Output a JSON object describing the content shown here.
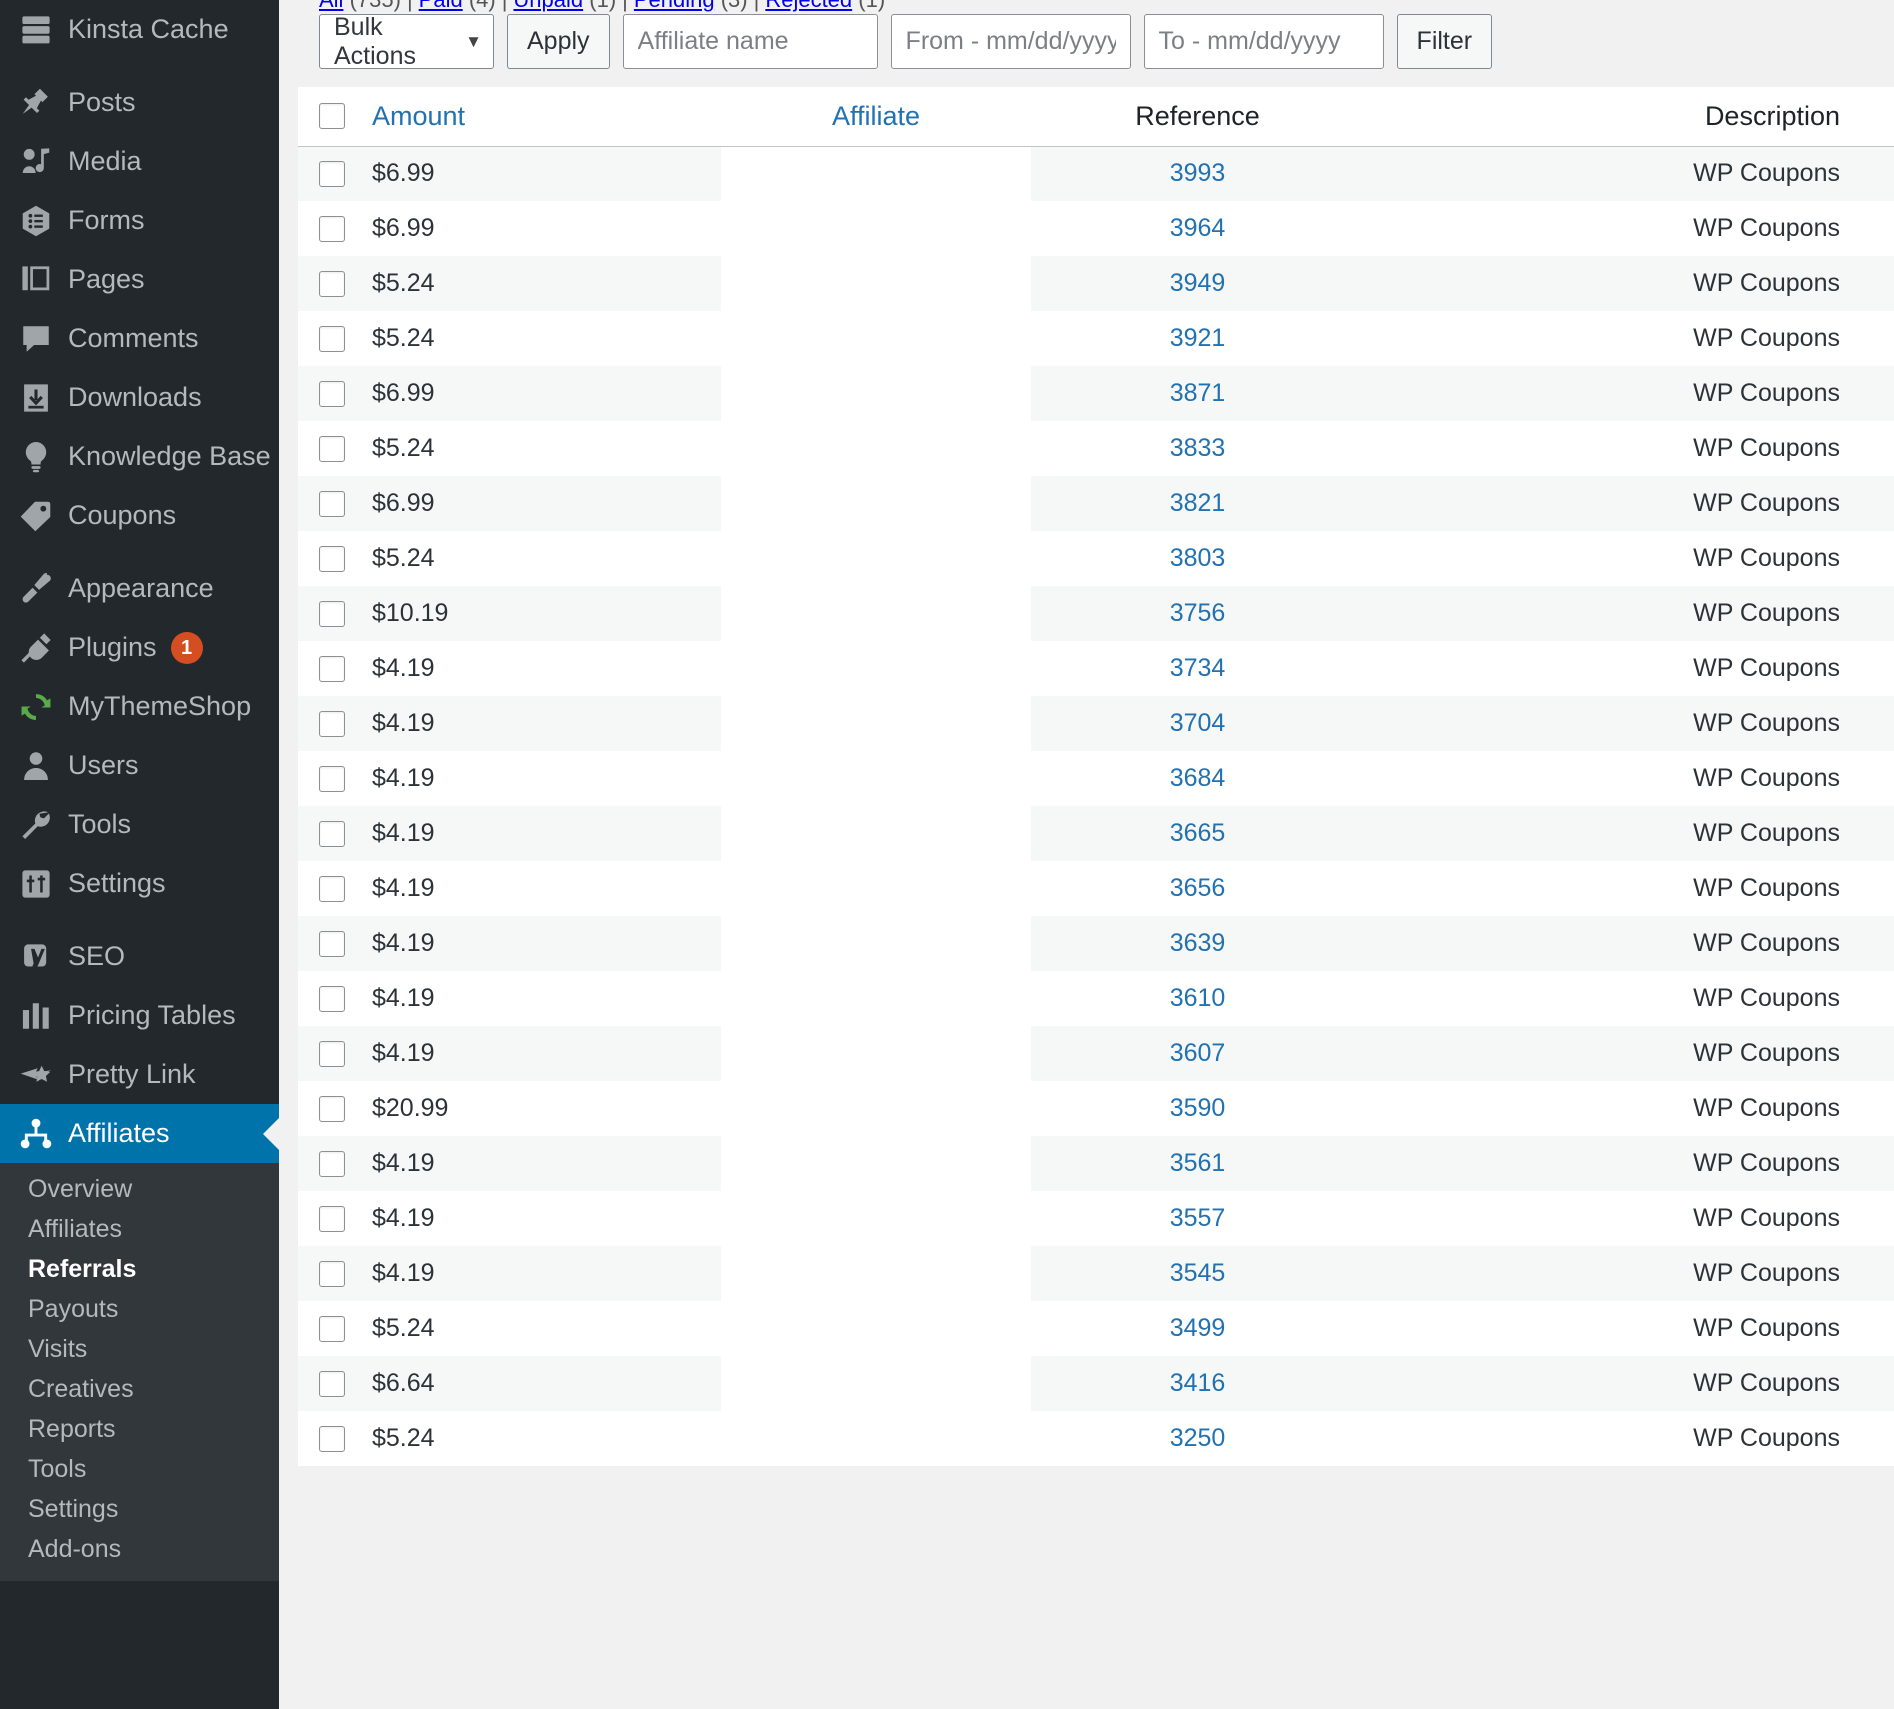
{
  "sidebar": {
    "items": [
      {
        "label": "Kinsta Cache",
        "icon": "server-icon"
      },
      {
        "label": "Posts",
        "icon": "pin-icon",
        "gap": true
      },
      {
        "label": "Media",
        "icon": "media-icon"
      },
      {
        "label": "Forms",
        "icon": "forms-icon"
      },
      {
        "label": "Pages",
        "icon": "pages-icon"
      },
      {
        "label": "Comments",
        "icon": "comments-icon"
      },
      {
        "label": "Downloads",
        "icon": "download-icon"
      },
      {
        "label": "Knowledge Base",
        "icon": "lightbulb-icon"
      },
      {
        "label": "Coupons",
        "icon": "tag-icon"
      },
      {
        "label": "Appearance",
        "icon": "paintbrush-icon",
        "gap": true
      },
      {
        "label": "Plugins",
        "icon": "plug-icon",
        "badge": "1"
      },
      {
        "label": "MyThemeShop",
        "icon": "refresh-icon"
      },
      {
        "label": "Users",
        "icon": "user-icon"
      },
      {
        "label": "Tools",
        "icon": "wrench-icon"
      },
      {
        "label": "Settings",
        "icon": "sliders-icon"
      },
      {
        "label": "SEO",
        "icon": "yoast-icon",
        "gap": true
      },
      {
        "label": "Pricing Tables",
        "icon": "bar-chart-icon"
      },
      {
        "label": "Pretty Link",
        "icon": "pretty-link-icon"
      },
      {
        "label": "Affiliates",
        "icon": "affiliates-icon",
        "current": true
      }
    ],
    "submenu": [
      {
        "label": "Overview"
      },
      {
        "label": "Affiliates"
      },
      {
        "label": "Referrals",
        "active": true
      },
      {
        "label": "Payouts"
      },
      {
        "label": "Visits"
      },
      {
        "label": "Creatives"
      },
      {
        "label": "Reports"
      },
      {
        "label": "Tools"
      },
      {
        "label": "Settings"
      },
      {
        "label": "Add-ons"
      }
    ]
  },
  "toolbar": {
    "bulk_actions_label": "Bulk Actions",
    "caret_glyph": "▼",
    "apply_label": "Apply",
    "affiliate_name_placeholder": "Affiliate name",
    "from_date_placeholder": "From - mm/dd/yyyy",
    "to_date_placeholder": "To - mm/dd/yyyy",
    "filter_label": "Filter",
    "affiliate_name_value": "",
    "from_date_value": "",
    "to_date_value": ""
  },
  "table": {
    "columns": {
      "checkbox": "",
      "amount": "Amount",
      "affiliate": "Affiliate",
      "reference": "Reference",
      "description": "Description"
    },
    "rows": [
      {
        "amount": "$6.99",
        "affiliate": "",
        "reference": "3993",
        "description": "WP Coupons"
      },
      {
        "amount": "$6.99",
        "affiliate": "",
        "reference": "3964",
        "description": "WP Coupons"
      },
      {
        "amount": "$5.24",
        "affiliate": "",
        "reference": "3949",
        "description": "WP Coupons"
      },
      {
        "amount": "$5.24",
        "affiliate": "",
        "reference": "3921",
        "description": "WP Coupons"
      },
      {
        "amount": "$6.99",
        "affiliate": "",
        "reference": "3871",
        "description": "WP Coupons"
      },
      {
        "amount": "$5.24",
        "affiliate": "",
        "reference": "3833",
        "description": "WP Coupons"
      },
      {
        "amount": "$6.99",
        "affiliate": "",
        "reference": "3821",
        "description": "WP Coupons"
      },
      {
        "amount": "$5.24",
        "affiliate": "",
        "reference": "3803",
        "description": "WP Coupons"
      },
      {
        "amount": "$10.19",
        "affiliate": "",
        "reference": "3756",
        "description": "WP Coupons"
      },
      {
        "amount": "$4.19",
        "affiliate": "",
        "reference": "3734",
        "description": "WP Coupons"
      },
      {
        "amount": "$4.19",
        "affiliate": "",
        "reference": "3704",
        "description": "WP Coupons"
      },
      {
        "amount": "$4.19",
        "affiliate": "",
        "reference": "3684",
        "description": "WP Coupons"
      },
      {
        "amount": "$4.19",
        "affiliate": "",
        "reference": "3665",
        "description": "WP Coupons"
      },
      {
        "amount": "$4.19",
        "affiliate": "",
        "reference": "3656",
        "description": "WP Coupons"
      },
      {
        "amount": "$4.19",
        "affiliate": "",
        "reference": "3639",
        "description": "WP Coupons"
      },
      {
        "amount": "$4.19",
        "affiliate": "",
        "reference": "3610",
        "description": "WP Coupons"
      },
      {
        "amount": "$4.19",
        "affiliate": "",
        "reference": "3607",
        "description": "WP Coupons"
      },
      {
        "amount": "$20.99",
        "affiliate": "",
        "reference": "3590",
        "description": "WP Coupons"
      },
      {
        "amount": "$4.19",
        "affiliate": "",
        "reference": "3561",
        "description": "WP Coupons"
      },
      {
        "amount": "$4.19",
        "affiliate": "",
        "reference": "3557",
        "description": "WP Coupons"
      },
      {
        "amount": "$4.19",
        "affiliate": "",
        "reference": "3545",
        "description": "WP Coupons"
      },
      {
        "amount": "$5.24",
        "affiliate": "",
        "reference": "3499",
        "description": "WP Coupons"
      },
      {
        "amount": "$6.64",
        "affiliate": "",
        "reference": "3416",
        "description": "WP Coupons"
      },
      {
        "amount": "$5.24",
        "affiliate": "",
        "reference": "3250",
        "description": "WP Coupons"
      }
    ]
  },
  "colors": {
    "accent": "#0073aa",
    "link": "#2271b1",
    "sidebar_bg": "#23282d",
    "submenu_bg": "#32373c",
    "badge_bg": "#d54e21",
    "row_alt_bg": "#f6f7f7"
  }
}
